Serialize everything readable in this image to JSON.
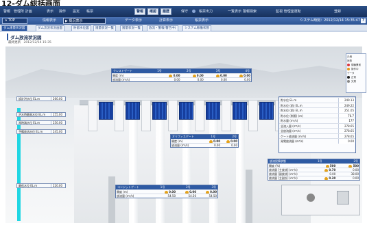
{
  "heading": "12-ダム総括画面",
  "topbar": {
    "items": [
      "警報",
      "管理所 計画",
      "表示",
      "操作",
      "設定",
      "帳票",
      "保守",
      "帳票出力",
      "一覧表示",
      "警報検索",
      "登録"
    ],
    "buttons": [
      "警報",
      "確認",
      "履歴"
    ],
    "right_label": "監視 管理室運転"
  },
  "secbar": {
    "top_label": "TOP",
    "items": [
      "情報表示",
      "概況表示",
      "データ表示",
      "計算表示",
      "帳票表示"
    ],
    "active_index": 1,
    "system_time": "システム時刻：2012/12/14 15:35:47",
    "help": "?"
  },
  "tabs": [
    "ダム諸量状況図",
    "ダム流況状況画面",
    "貯留水位図",
    "諸量状況一覧",
    "諸量状況一覧",
    "放流・警報(警告中)",
    "システム稼働状態"
  ],
  "active_tab": 0,
  "title": "ダム放流状況図",
  "updated": "最終更新　2012/12/14 15:35",
  "legend": {
    "title": "凡例",
    "items": [
      {
        "label": "状態",
        "color": ""
      },
      {
        "label": "閉鎖異常",
        "color": "#d9363e"
      },
      {
        "label": "操作中",
        "color": "#e69a1c"
      },
      {
        "label": "データ",
        "color": ""
      },
      {
        "label": "正常",
        "color": "#222222"
      },
      {
        "label": "欠測",
        "color": "#888888"
      }
    ]
  },
  "top_panel": {
    "title": "クレストゲート",
    "cols": [
      "1号",
      "2号",
      "3号",
      "4号"
    ],
    "rows": [
      {
        "label": "開度 (m)",
        "values": [
          "0.00",
          "0.00",
          "0.00",
          "0.00"
        ]
      },
      {
        "label": "放流量 (m³/s)",
        "values": [
          "0.00",
          "0.00",
          "0.00",
          "0.00"
        ]
      }
    ]
  },
  "left_boxes": [
    {
      "label": "設計洪水位 EL.m",
      "value": "260.00"
    },
    {
      "label": "洪水時最高水位 EL.m",
      "value": "255.00"
    },
    {
      "label": "常時満水位 EL.m",
      "value": "250.00"
    },
    {
      "label": "予備放流水位 EL.m",
      "value": "245.00"
    },
    {
      "label": "最低水位 EL.m",
      "value": "220.00"
    }
  ],
  "right_panel": {
    "rows": [
      {
        "label": "貯水位 EL.m",
        "value": "249.13"
      },
      {
        "label": "貯水位 (前) EL.m",
        "value": "249.22"
      },
      {
        "label": "貯水位 (前) EL.m",
        "value": "251.05"
      },
      {
        "label": "貯水位 (制限) (m)",
        "value": "76.7"
      },
      {
        "label": "貯水量 (m³/s)",
        "value": "177"
      },
      {
        "label": "全流入量 (m³/s)",
        "value": "278.65"
      },
      {
        "label": "全放流量 (m³/s)",
        "value": "278.65"
      },
      {
        "label": "ゲート放流量 (m³/s)",
        "value": "278.65"
      },
      {
        "label": "発電放流量 (m³/s)",
        "value": "0.00"
      }
    ]
  },
  "middle_panel": {
    "title": "オリフィスゲート",
    "cols": [
      "1号",
      "2号"
    ],
    "rows": [
      {
        "label": "開度 (m)",
        "values": [
          "0.00",
          "0.00"
        ]
      },
      {
        "label": "放流量 (m³/s)",
        "values": [
          "0.00",
          "0.00"
        ]
      }
    ]
  },
  "bottom_panel": {
    "title": "コンジットゲート",
    "cols": [
      "1号",
      "2号",
      "3号"
    ],
    "rows": [
      {
        "label": "開度 (m)",
        "values": [
          "0.00",
          "0.00",
          "0.00"
        ]
      },
      {
        "label": "放流量 (m³/s)",
        "values": [
          "54.50",
          "54.50",
          "54.50"
        ]
      }
    ]
  },
  "discharge_panel": {
    "title": "放流設備状態",
    "cols": [
      "1号",
      "2号"
    ],
    "rows": [
      {
        "label": "開度 (%)",
        "values": [
          "500",
          "500"
        ]
      },
      {
        "label": "放流量 [主放流] (m³/s)",
        "values": [
          "0.70",
          "0.00"
        ]
      },
      {
        "label": "放流量 [副放流] (m³/s)",
        "values": [
          "0.00",
          "38.00"
        ]
      },
      {
        "label": "放流量 [主副計] (m³/s)",
        "values": [
          "0.30",
          "0.00"
        ]
      }
    ]
  }
}
